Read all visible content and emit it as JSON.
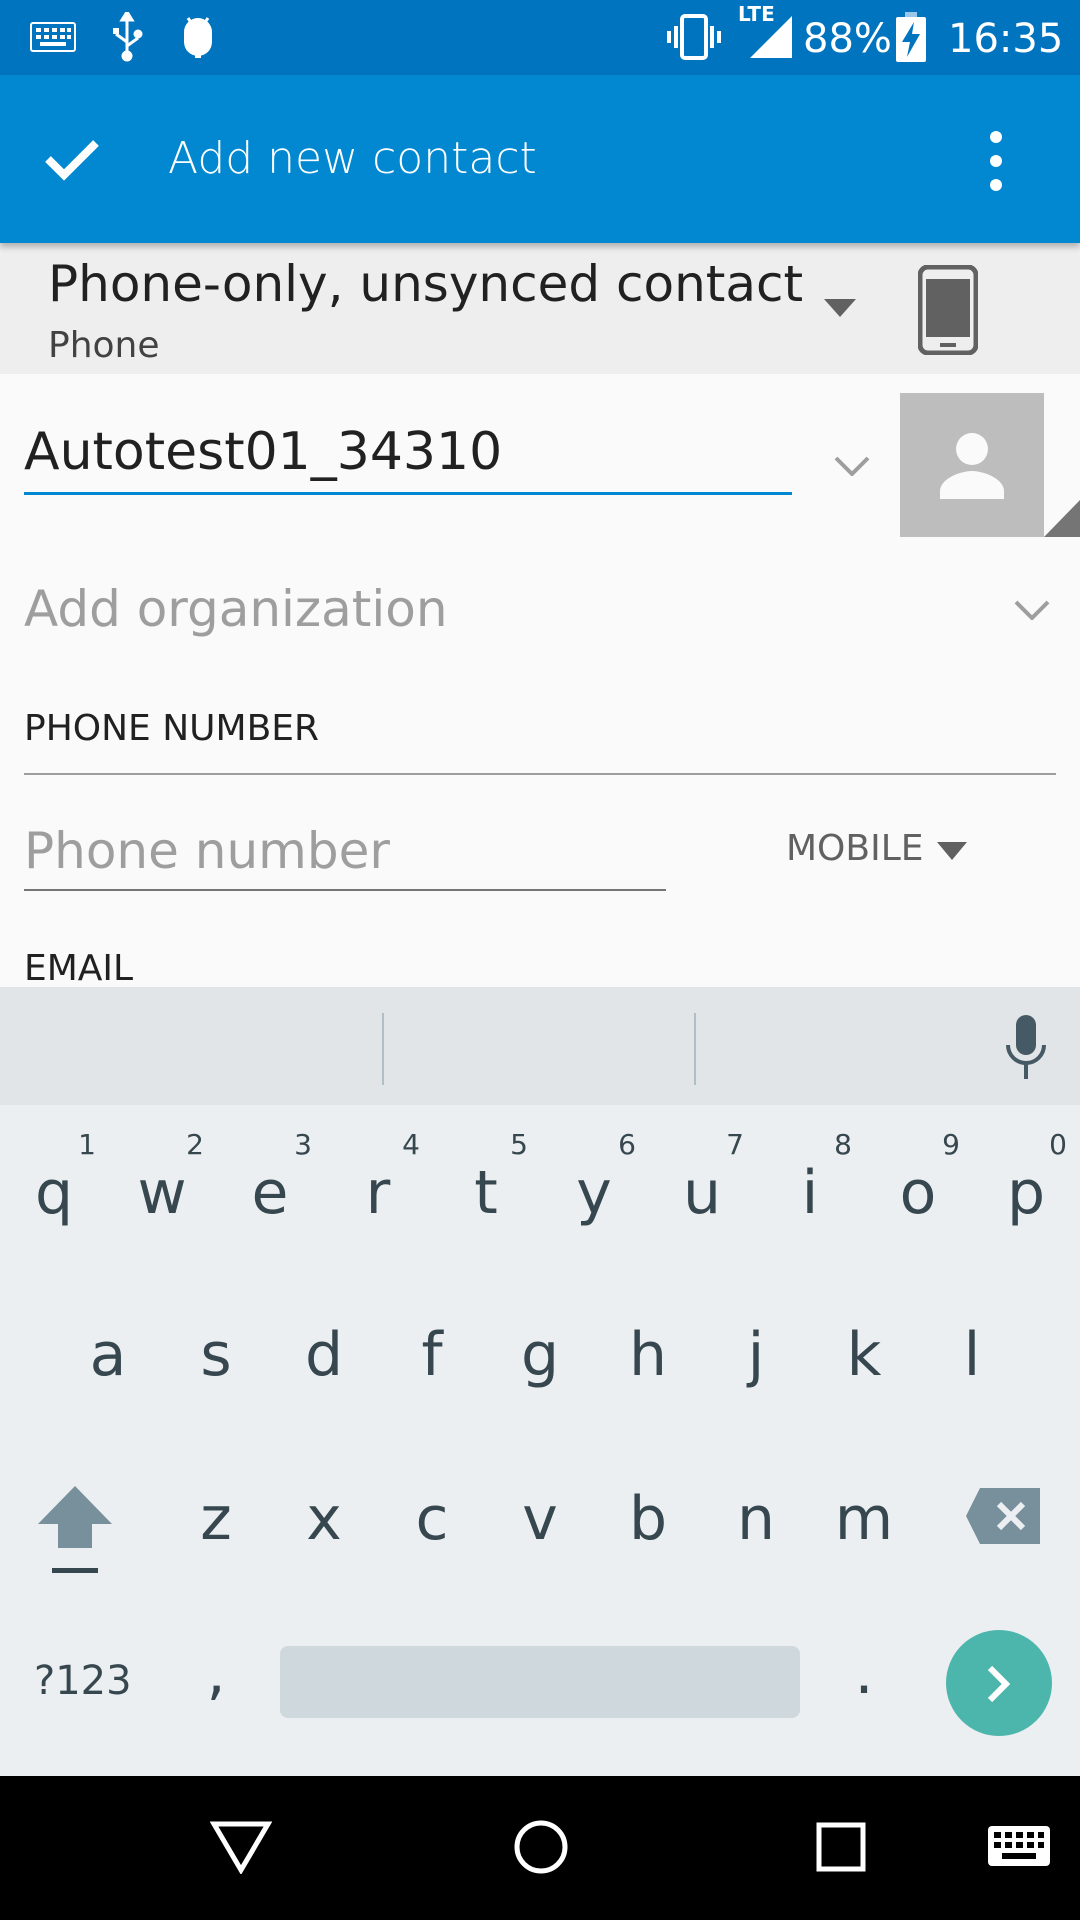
{
  "status_bar": {
    "battery": "88%",
    "time": "16:35",
    "network": "LTE",
    "icons": [
      "keyboard-icon",
      "usb-icon",
      "android-debug-icon",
      "vibrate-icon",
      "signal-icon",
      "battery-charging-icon"
    ]
  },
  "app_bar": {
    "title": "Add new contact",
    "icons": [
      "check-icon",
      "overflow-menu-icon"
    ]
  },
  "account": {
    "name": "Phone-only, unsynced contact",
    "type": "Phone"
  },
  "form": {
    "name_value": "Autotest01_34310",
    "organization_placeholder": "Add organization",
    "phone_section": "PHONE NUMBER",
    "phone_placeholder": "Phone number",
    "phone_type": "MOBILE",
    "email_section": "EMAIL"
  },
  "keyboard": {
    "row1": [
      "q",
      "w",
      "e",
      "r",
      "t",
      "y",
      "u",
      "i",
      "o",
      "p"
    ],
    "row1_hints": [
      "1",
      "2",
      "3",
      "4",
      "5",
      "6",
      "7",
      "8",
      "9",
      "0"
    ],
    "row2": [
      "a",
      "s",
      "d",
      "f",
      "g",
      "h",
      "j",
      "k",
      "l"
    ],
    "row3": [
      "z",
      "x",
      "c",
      "v",
      "b",
      "n",
      "m"
    ],
    "symbols_key": "?123",
    "comma_key": ",",
    "period_key": ".",
    "accent_color": "#4db6ac"
  },
  "colors": {
    "status_bar": "#0174bf",
    "app_bar": "#0288d1",
    "accent": "#0288d1"
  }
}
